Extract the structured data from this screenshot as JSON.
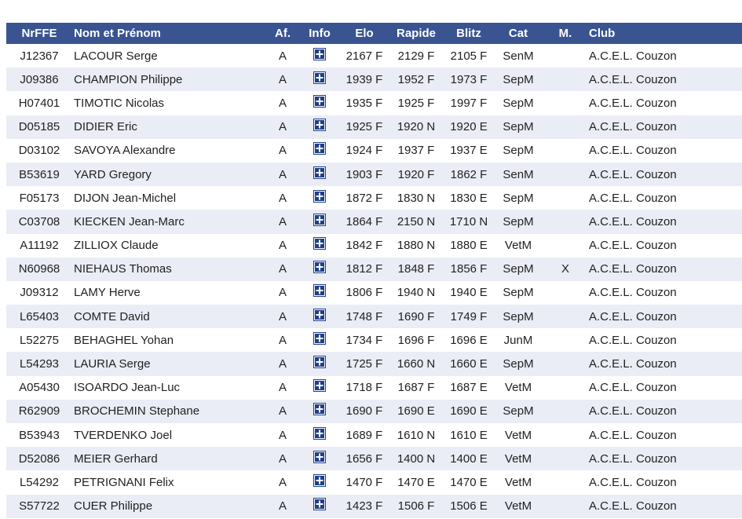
{
  "table": {
    "headers": {
      "nrffe": "NrFFE",
      "nom": "Nom et Prénom",
      "af": "Af.",
      "info": "Info",
      "elo": "Elo",
      "rapide": "Rapide",
      "blitz": "Blitz",
      "cat": "Cat",
      "m": "M.",
      "club": "Club"
    },
    "colors": {
      "header_bg": "#3a5492",
      "row_alt_bg": "#eaedf5",
      "icon_color": "#1f3f8a"
    },
    "info_icon": "plus-square-icon",
    "rows": [
      {
        "nrffe": "J12367",
        "nom": "LACOUR Serge",
        "af": "A",
        "elo": "2167 F",
        "rapide": "2129 F",
        "blitz": "2105 F",
        "cat": "SenM",
        "m": "",
        "club": "A.C.E.L. Couzon"
      },
      {
        "nrffe": "J09386",
        "nom": "CHAMPION Philippe",
        "af": "A",
        "elo": "1939 F",
        "rapide": "1952 F",
        "blitz": "1973 F",
        "cat": "SepM",
        "m": "",
        "club": "A.C.E.L. Couzon"
      },
      {
        "nrffe": "H07401",
        "nom": "TIMOTIC Nicolas",
        "af": "A",
        "elo": "1935 F",
        "rapide": "1925 F",
        "blitz": "1997 F",
        "cat": "SepM",
        "m": "",
        "club": "A.C.E.L. Couzon"
      },
      {
        "nrffe": "D05185",
        "nom": "DIDIER Eric",
        "af": "A",
        "elo": "1925 F",
        "rapide": "1920 N",
        "blitz": "1920 E",
        "cat": "SepM",
        "m": "",
        "club": "A.C.E.L. Couzon"
      },
      {
        "nrffe": "D03102",
        "nom": "SAVOYA Alexandre",
        "af": "A",
        "elo": "1924 F",
        "rapide": "1937 F",
        "blitz": "1937 E",
        "cat": "SepM",
        "m": "",
        "club": "A.C.E.L. Couzon"
      },
      {
        "nrffe": "B53619",
        "nom": "YARD Gregory",
        "af": "A",
        "elo": "1903 F",
        "rapide": "1920 F",
        "blitz": "1862 F",
        "cat": "SenM",
        "m": "",
        "club": "A.C.E.L. Couzon"
      },
      {
        "nrffe": "F05173",
        "nom": "DIJON Jean-Michel",
        "af": "A",
        "elo": "1872 F",
        "rapide": "1830 N",
        "blitz": "1830 E",
        "cat": "SepM",
        "m": "",
        "club": "A.C.E.L. Couzon"
      },
      {
        "nrffe": "C03708",
        "nom": "KIECKEN Jean-Marc",
        "af": "A",
        "elo": "1864 F",
        "rapide": "2150 N",
        "blitz": "1710 N",
        "cat": "SepM",
        "m": "",
        "club": "A.C.E.L. Couzon"
      },
      {
        "nrffe": "A11192",
        "nom": "ZILLIOX Claude",
        "af": "A",
        "elo": "1842 F",
        "rapide": "1880 N",
        "blitz": "1880 E",
        "cat": "VetM",
        "m": "",
        "club": "A.C.E.L. Couzon"
      },
      {
        "nrffe": "N60968",
        "nom": "NIEHAUS Thomas",
        "af": "A",
        "elo": "1812 F",
        "rapide": "1848 F",
        "blitz": "1856 F",
        "cat": "SepM",
        "m": "X",
        "club": "A.C.E.L. Couzon"
      },
      {
        "nrffe": "J09312",
        "nom": "LAMY Herve",
        "af": "A",
        "elo": "1806 F",
        "rapide": "1940 N",
        "blitz": "1940 E",
        "cat": "SepM",
        "m": "",
        "club": "A.C.E.L. Couzon"
      },
      {
        "nrffe": "L65403",
        "nom": "COMTE David",
        "af": "A",
        "elo": "1748 F",
        "rapide": "1690 F",
        "blitz": "1749 F",
        "cat": "SepM",
        "m": "",
        "club": "A.C.E.L. Couzon"
      },
      {
        "nrffe": "L52275",
        "nom": "BEHAGHEL Yohan",
        "af": "A",
        "elo": "1734 F",
        "rapide": "1696 F",
        "blitz": "1696 E",
        "cat": "JunM",
        "m": "",
        "club": "A.C.E.L. Couzon"
      },
      {
        "nrffe": "L54293",
        "nom": "LAURIA Serge",
        "af": "A",
        "elo": "1725 F",
        "rapide": "1660 N",
        "blitz": "1660 E",
        "cat": "SepM",
        "m": "",
        "club": "A.C.E.L. Couzon"
      },
      {
        "nrffe": "A05430",
        "nom": "ISOARDO Jean-Luc",
        "af": "A",
        "elo": "1718 F",
        "rapide": "1687 F",
        "blitz": "1687 E",
        "cat": "VetM",
        "m": "",
        "club": "A.C.E.L. Couzon"
      },
      {
        "nrffe": "R62909",
        "nom": "BROCHEMIN Stephane",
        "af": "A",
        "elo": "1690 F",
        "rapide": "1690 E",
        "blitz": "1690 E",
        "cat": "SepM",
        "m": "",
        "club": "A.C.E.L. Couzon"
      },
      {
        "nrffe": "B53943",
        "nom": "TVERDENKO Joel",
        "af": "A",
        "elo": "1689 F",
        "rapide": "1610 N",
        "blitz": "1610 E",
        "cat": "VetM",
        "m": "",
        "club": "A.C.E.L. Couzon"
      },
      {
        "nrffe": "D52086",
        "nom": "MEIER Gerhard",
        "af": "A",
        "elo": "1656 F",
        "rapide": "1400 N",
        "blitz": "1400 E",
        "cat": "VetM",
        "m": "",
        "club": "A.C.E.L. Couzon"
      },
      {
        "nrffe": "L54292",
        "nom": "PETRIGNANI Felix",
        "af": "A",
        "elo": "1470 F",
        "rapide": "1470 E",
        "blitz": "1470 E",
        "cat": "VetM",
        "m": "",
        "club": "A.C.E.L. Couzon"
      },
      {
        "nrffe": "S57722",
        "nom": "CUER Philippe",
        "af": "A",
        "elo": "1423 F",
        "rapide": "1506 F",
        "blitz": "1506 E",
        "cat": "VetM",
        "m": "",
        "club": "A.C.E.L. Couzon"
      }
    ]
  }
}
